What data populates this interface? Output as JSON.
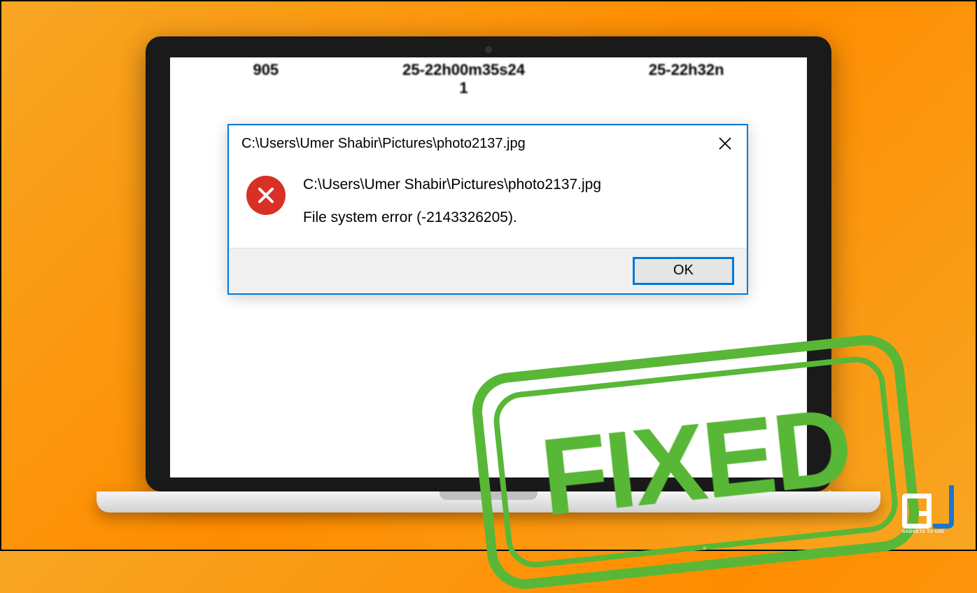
{
  "background_files": {
    "item1": "905",
    "item2_line1": "25-22h00m35s24",
    "item2_line2": "1",
    "item3": "25-22h32n"
  },
  "dialog": {
    "title": "C:\\Users\\Umer Shabir\\Pictures\\photo2137.jpg",
    "message_path": "C:\\Users\\Umer Shabir\\Pictures\\photo2137.jpg",
    "message_error": "File system error (-2143326205).",
    "ok_label": "OK"
  },
  "stamp": {
    "text": "FIXED"
  },
  "logo": {
    "subtitle": "GADGETS TO USE"
  },
  "colors": {
    "accent_blue": "#0078d7",
    "error_red": "#d93025",
    "stamp_green": "#5cb23e",
    "background_orange": "#ff8c00"
  }
}
